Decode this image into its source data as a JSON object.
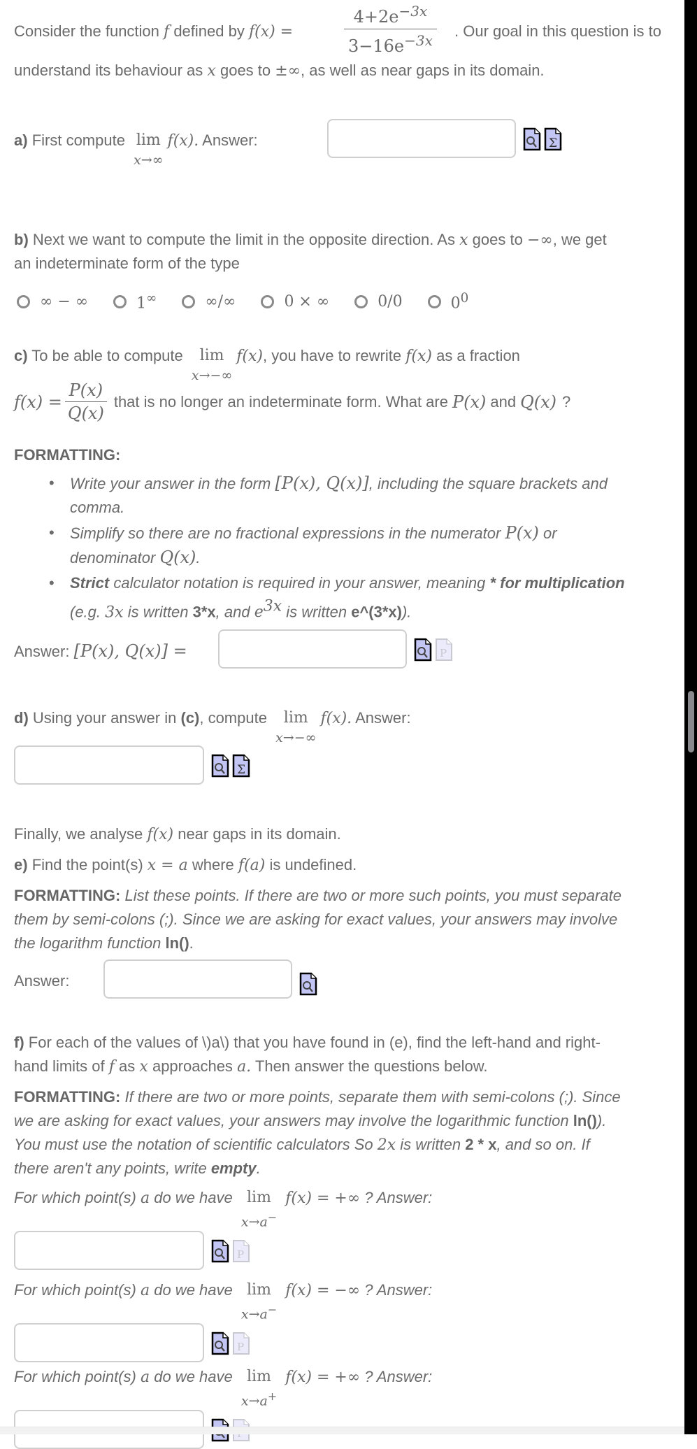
{
  "intro": {
    "text_before": "Consider the function",
    "f_symbol": "f",
    "text_defined_by": "defined by",
    "f_of_x": "f(x) =",
    "numerator": "4+2e",
    "numerator_exp": "−3x",
    "denominator": "3−16e",
    "denominator_exp": "−3x",
    "text_after": ". Our goal in this question is to",
    "line2": "understand its behaviour as",
    "line2_x": "x",
    "line2_mid": "goes to",
    "line2_pm": "±∞",
    "line2_end": ", as well as near gaps in its domain."
  },
  "part_a": {
    "label": "a)",
    "text": "First compute",
    "lim": "lim",
    "lim_sub": "x→∞",
    "fx": "f(x).",
    "answer_label": "Answer:",
    "answer_value": ""
  },
  "part_b": {
    "label": "b)",
    "text1": "Next we want to compute the limit in the opposite direction.  As",
    "x": "x",
    "text2": "goes to",
    "neg_inf": "−∞",
    "text3": ", we get",
    "line2": "an indeterminate form of the type",
    "options": [
      {
        "label": "∞ − ∞",
        "sup": ""
      },
      {
        "label": "1",
        "sup": "∞"
      },
      {
        "label": "∞/∞",
        "sup": ""
      },
      {
        "label": "0 × ∞",
        "sup": ""
      },
      {
        "label": "0/0",
        "sup": ""
      },
      {
        "label": "0",
        "sup": "0"
      }
    ]
  },
  "part_c": {
    "label": "c)",
    "text1": "To be able to compute",
    "lim": "lim",
    "lim_sub": "x→−∞",
    "fx": "f(x)",
    "text2": ", you have to rewrite",
    "fx2": "f(x)",
    "text3": "as a fraction",
    "lhs": "f(x) =",
    "frac_num": "P(x)",
    "frac_den": "Q(x)",
    "text4": "that is no longer an indeterminate form.  What are",
    "px": "P(x)",
    "and": "and",
    "qx": "Q(x)",
    "q_mark": "?",
    "formatting_label": "FORMATTING:",
    "bullets": {
      "b1_a": "Write your answer in the form",
      "b1_math": "[P(x), Q(x)]",
      "b1_b": ", including the square brackets and",
      "b1_c": "comma.",
      "b2_a": "Simplify so there are no fractional expressions in the numerator",
      "b2_math1": "P(x)",
      "b2_b": "or",
      "b2_c": "denominator",
      "b2_math2": "Q(x)",
      "b2_d": ".",
      "b3_strong": "Strict",
      "b3_a": "calculator notation is required in your answer, meaning",
      "b3_bold": "* for multiplication",
      "b3_b": "(e.g.",
      "b3_m1": "3x",
      "b3_c": "is written",
      "b3_code1": "3*x",
      "b3_d": ", and",
      "b3_m2_base": "e",
      "b3_m2_exp": "3x",
      "b3_e": "is written",
      "b3_code2": "e^(3*x)",
      "b3_f": ")."
    },
    "answer_label": "Answer:",
    "answer_math": "[P(x), Q(x)] =",
    "answer_value": ""
  },
  "part_d": {
    "label": "d)",
    "text1": "Using your answer in",
    "ref": "(c)",
    "text2": ", compute",
    "lim": "lim",
    "lim_sub": "x→−∞",
    "fx": "f(x).",
    "answer_label": "Answer:",
    "answer_value": ""
  },
  "finally": {
    "text1": "Finally, we analyse",
    "fx": "f(x)",
    "text2": "near gaps in its domain."
  },
  "part_e": {
    "label": "e)",
    "text1": "Find the point(s)",
    "math1": "x = a",
    "text2": "where",
    "math2": "f(a)",
    "text3": "is undefined.",
    "formatting_label": "FORMATTING:",
    "fmt_line1": "List these points. If there are two or more such points, you must separate",
    "fmt_line2": "them by semi-colons (;). Since we are asking for exact values, your answers may involve",
    "fmt_line3": "the logarithm function",
    "fmt_ln": "ln()",
    "fmt_end": ".",
    "answer_label": "Answer:",
    "answer_value": ""
  },
  "part_f": {
    "label": "f)",
    "line1": "For each of the values of \\)a\\) that you have found in (e), find the left-hand and right-",
    "line2_a": "hand limits of",
    "line2_f": "f",
    "line2_b": "as",
    "line2_x": "x",
    "line2_c": "approaches",
    "line2_a_sym": "a.",
    "line2_d": "Then answer the questions below.",
    "formatting_label": "FORMATTING:",
    "fmt1": "If there are two or more points, separate them with semi-colons (;). Since",
    "fmt2": "we are asking for exact values, your answers may involve the logarithmic function",
    "fmt2_ln": "ln()",
    "fmt2_end": ").",
    "fmt3_a": "You must use the notation of scientific calculators   So",
    "fmt3_m": "2x",
    "fmt3_b": "is written",
    "fmt3_code": "2 * x",
    "fmt3_c": ", and so on.  If",
    "fmt4_a": "there aren't any points, write",
    "fmt4_empty": "empty",
    "fmt4_end": ".",
    "questions": [
      {
        "prefix": "For which point(s)",
        "a": "a",
        "mid": "do we have",
        "lim": "lim",
        "lim_sub": "x→a",
        "side": "−",
        "rhs": "f(x) = +∞",
        "suffix": "?  Answer:",
        "value": ""
      },
      {
        "prefix": "For which point(s)",
        "a": "a",
        "mid": "do we have",
        "lim": "lim",
        "lim_sub": "x→a",
        "side": "−",
        "rhs": "f(x) = −∞",
        "suffix": "? Answer:",
        "value": ""
      },
      {
        "prefix": "For which point(s)",
        "a": "a",
        "mid": "do we have",
        "lim": "lim",
        "lim_sub": "x→a",
        "side": "+",
        "rhs": "f(x) = +∞",
        "suffix": "?  Answer:",
        "value": ""
      }
    ]
  },
  "icons": {
    "preview": "preview-magnifier-icon",
    "equation_editor": "sigma-equation-icon",
    "disabled_p": "p-document-icon"
  }
}
